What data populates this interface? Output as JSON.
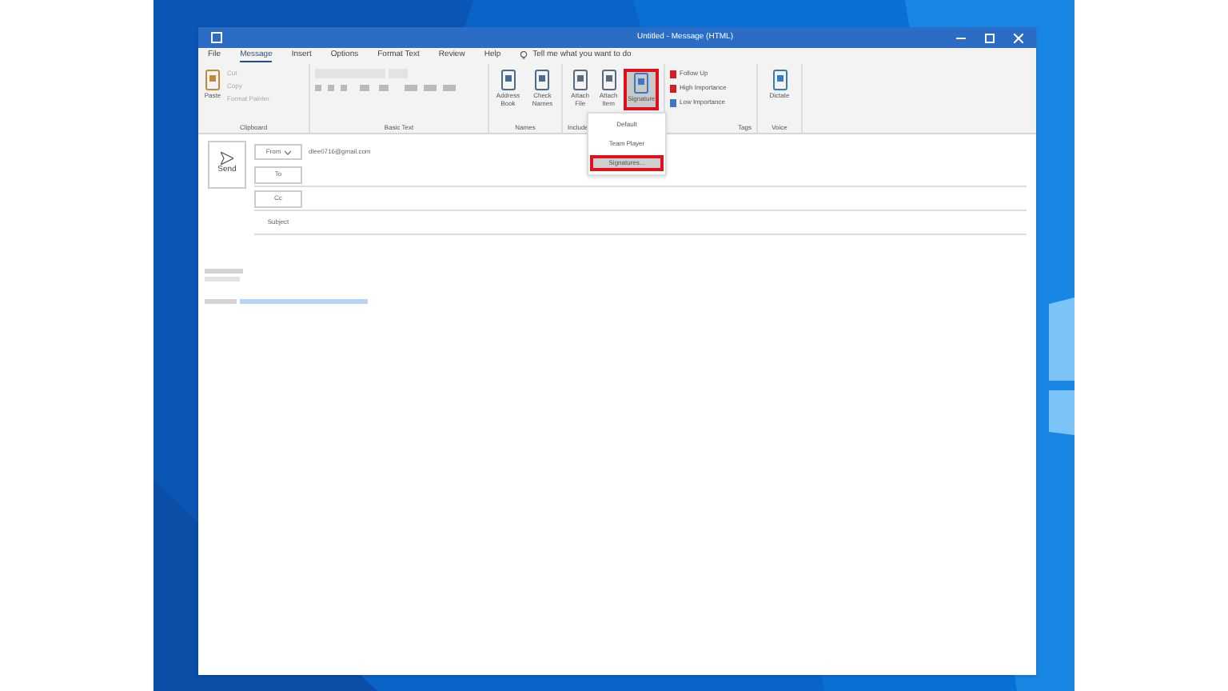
{
  "window": {
    "title": "Untitled - Message (HTML)"
  },
  "tabs": [
    {
      "label": "File",
      "selected": false
    },
    {
      "label": "Message",
      "selected": true
    },
    {
      "label": "Insert",
      "selected": false
    },
    {
      "label": "Options",
      "selected": false
    },
    {
      "label": "Format Text",
      "selected": false
    },
    {
      "label": "Review",
      "selected": false
    },
    {
      "label": "Help",
      "selected": false
    }
  ],
  "tell_me": "Tell me what you want to do",
  "ribbon": {
    "clipboard": {
      "label": "Clipboard",
      "paste": "Paste",
      "items": [
        "Cut",
        "Copy",
        "Format Painter"
      ]
    },
    "basic_text": {
      "label": "Basic Text"
    },
    "names": {
      "label": "Names",
      "buttons": [
        "Address Book",
        "Check Names"
      ]
    },
    "include": {
      "label": "Include",
      "buttons": [
        "Attach File",
        "Attach Item",
        "Signature"
      ]
    },
    "tags": {
      "label": "Tags",
      "items": [
        "Follow Up",
        "High Importance",
        "Low Importance"
      ]
    },
    "voice": {
      "label": "Voice",
      "button": "Dictate"
    }
  },
  "signature_menu": {
    "items": [
      {
        "label": "Default",
        "selected": false
      },
      {
        "label": "Team Player",
        "selected": false
      },
      {
        "label": "Signatures...",
        "selected": true
      }
    ]
  },
  "compose": {
    "send": "Send",
    "from_label": "From",
    "from_value": "dlee0716@gmail.com",
    "to_label": "To",
    "cc_label": "Cc",
    "subject_label": "Subject"
  }
}
